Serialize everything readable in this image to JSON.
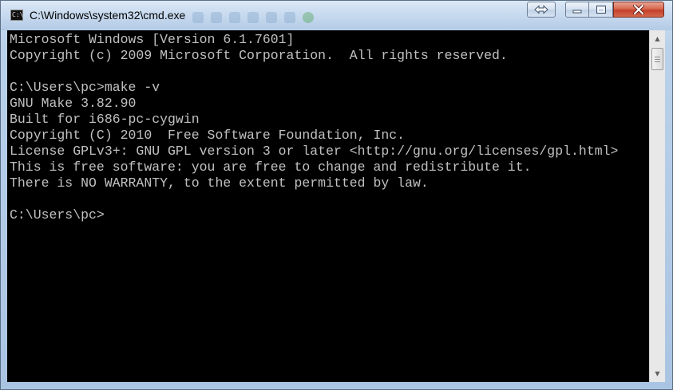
{
  "window": {
    "title": "C:\\Windows\\system32\\cmd.exe",
    "app_icon": "command-prompt-icon",
    "app_icon_glyph": "C:\\"
  },
  "caption_buttons": {
    "resize_icon": "⇔",
    "minimize_icon": "minimize-icon",
    "maximize_icon": "maximize-icon",
    "close_icon": "close-icon"
  },
  "console": {
    "text_color": "#c0c0c0",
    "background_color": "#000000",
    "lines": [
      "Microsoft Windows [Version 6.1.7601]",
      "Copyright (c) 2009 Microsoft Corporation.  All rights reserved.",
      "",
      "C:\\Users\\pc>make -v",
      "GNU Make 3.82.90",
      "Built for i686-pc-cygwin",
      "Copyright (C) 2010  Free Software Foundation, Inc.",
      "License GPLv3+: GNU GPL version 3 or later <http://gnu.org/licenses/gpl.html>",
      "This is free software: you are free to change and redistribute it.",
      "There is NO WARRANTY, to the extent permitted by law.",
      "",
      "C:\\Users\\pc>"
    ]
  },
  "scrollbar": {
    "up_icon": "▲",
    "down_icon": "▼"
  }
}
